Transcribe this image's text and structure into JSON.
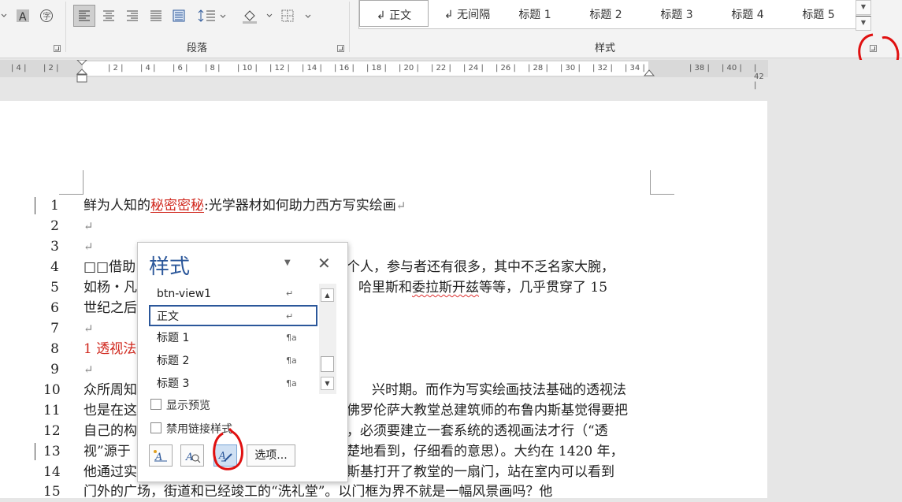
{
  "ribbon": {
    "paragraph_group_label": "段落",
    "styles_group_label": "样式",
    "gallery": [
      {
        "label": "↲ 正文",
        "selected": true
      },
      {
        "label": "↲ 无间隔",
        "selected": false
      },
      {
        "label": "标题 1",
        "selected": false
      },
      {
        "label": "标题 2",
        "selected": false
      },
      {
        "label": "标题 3",
        "selected": false
      },
      {
        "label": "标题 4",
        "selected": false
      },
      {
        "label": "标题 5",
        "selected": false
      }
    ]
  },
  "ruler": {
    "ticks": [
      "4",
      "2",
      "",
      "2",
      "4",
      "6",
      "8",
      "10",
      "12",
      "14",
      "16",
      "18",
      "20",
      "22",
      "24",
      "26",
      "28",
      "30",
      "32",
      "34",
      "",
      "38",
      "40",
      "42"
    ]
  },
  "document": {
    "lines": [
      {
        "num": "1"
      },
      {
        "num": "2",
        "text": "↵"
      },
      {
        "num": "3",
        "text": "↵"
      },
      {
        "num": "4",
        "a": "□□借助",
        "b": "个人，参与者还有很多，其中不乏名家大腕，"
      },
      {
        "num": "5",
        "a": "如杨・凡",
        "b": "哈里斯和",
        "c": "委拉斯开兹",
        "d": "等等，几乎贯穿了 15"
      },
      {
        "num": "6",
        "a": "世纪之后"
      },
      {
        "num": "7",
        "text": "↵"
      },
      {
        "num": "8",
        "a": "1 透视法"
      },
      {
        "num": "9",
        "text": "↵"
      },
      {
        "num": "10",
        "a": "众所周知",
        "b": "兴时期。而作为写实绘画技法基础的透视法"
      },
      {
        "num": "11",
        "a": "也是在这",
        "b": "佛罗伦萨大教堂总建筑师的布鲁内斯基觉得要把"
      },
      {
        "num": "12",
        "a": "自己的构",
        "b": "，必须要建立一套系统的透视画法才行（“透"
      },
      {
        "num": "13",
        "a": "视”源于",
        "b": "楚地看到，仔细看的意思）。大约在 1420 年，"
      },
      {
        "num": "14",
        "a": "他通过实",
        "b": "斯基打开了教堂的一扇门，站在室内可以看到"
      },
      {
        "num": "15",
        "a": "门外的广场，街道和已经竣工的“洗礼堂”。以门框为界不就是一幅风景画吗？他"
      }
    ],
    "line1": {
      "pre": "鲜为人知的",
      "red": "秘密密秘",
      "post": ":光学器材如何助力西方写实绘画",
      "ret": "↵"
    }
  },
  "styles_pane": {
    "title": "样式",
    "items": [
      {
        "name": "btn-view1",
        "mark": "↵"
      },
      {
        "name": "正文",
        "mark": "↵",
        "selected": true
      },
      {
        "name": "标题 1",
        "mark": "¶a"
      },
      {
        "name": "标题 2",
        "mark": "¶a"
      },
      {
        "name": "标题 3",
        "mark": "¶a"
      }
    ],
    "show_preview_label": "显示预览",
    "disable_linked_label": "禁用链接样式",
    "options_label": "选项..."
  }
}
